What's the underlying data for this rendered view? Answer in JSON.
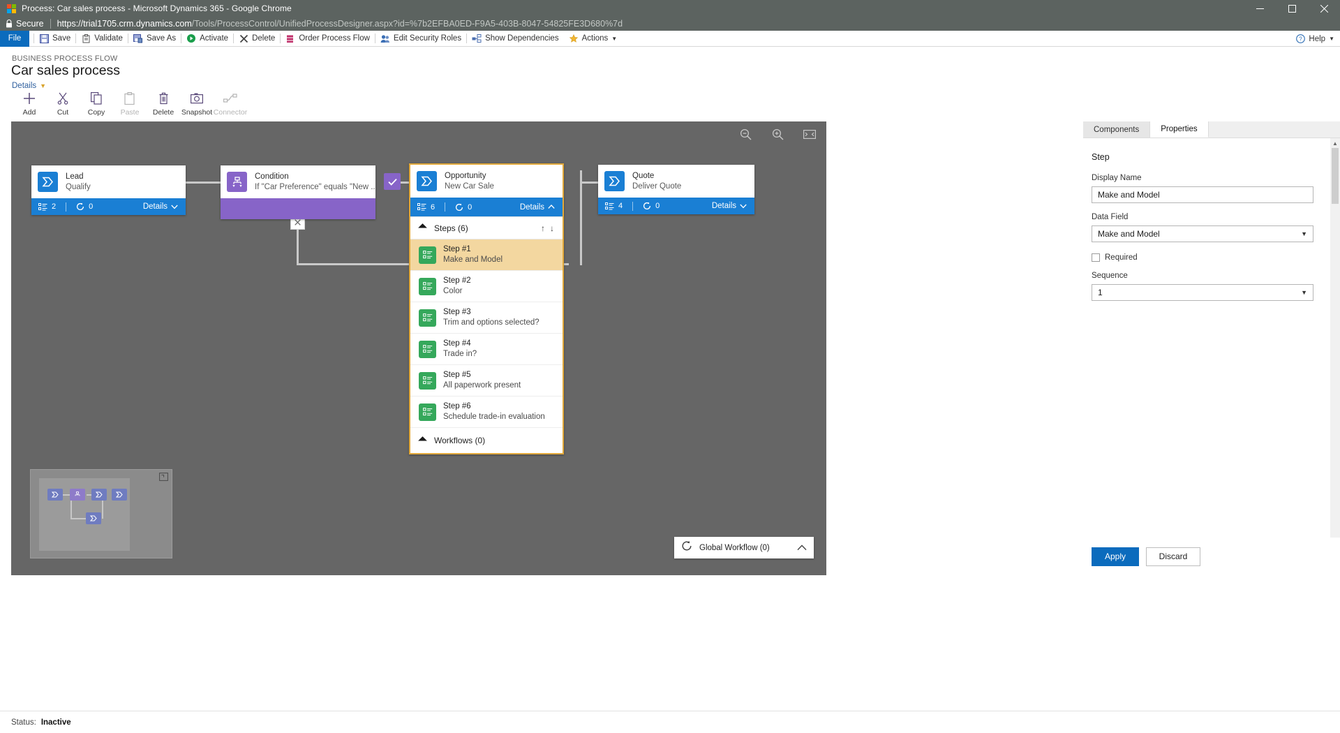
{
  "window": {
    "title": "Process: Car sales process - Microsoft Dynamics 365 - Google Chrome",
    "minimize": "minimize-icon",
    "maximize": "maximize-icon",
    "close": "close-icon"
  },
  "address": {
    "secure_label": "Secure",
    "url_host": "https://trial1705.crm.dynamics.com",
    "url_path": "/Tools/ProcessControl/UnifiedProcessDesigner.aspx?id=%7b2EFBA0ED-F9A5-403B-8047-54825FE3D680%7d"
  },
  "commandbar": {
    "file": "File",
    "items": [
      {
        "label": "Save",
        "icon": "save-icon"
      },
      {
        "label": "Validate",
        "icon": "validate-icon"
      },
      {
        "label": "Save As",
        "icon": "save-as-icon"
      },
      {
        "label": "Activate",
        "icon": "activate-icon"
      },
      {
        "label": "Delete",
        "icon": "delete-icon"
      },
      {
        "label": "Order Process Flow",
        "icon": "order-process-flow-icon"
      },
      {
        "label": "Edit Security Roles",
        "icon": "edit-security-roles-icon"
      },
      {
        "label": "Show Dependencies",
        "icon": "show-dependencies-icon"
      },
      {
        "label": "Actions",
        "icon": "actions-icon"
      }
    ],
    "help": "Help"
  },
  "header": {
    "kicker": "BUSINESS PROCESS FLOW",
    "title": "Car sales process",
    "details_link": "Details"
  },
  "toolbar": [
    {
      "label": "Add",
      "icon": "plus-icon",
      "disabled": false
    },
    {
      "label": "Cut",
      "icon": "scissors-icon",
      "disabled": false
    },
    {
      "label": "Copy",
      "icon": "copy-icon",
      "disabled": false
    },
    {
      "label": "Paste",
      "icon": "paste-icon",
      "disabled": true
    },
    {
      "label": "Delete",
      "icon": "trash-icon",
      "disabled": false
    },
    {
      "label": "Snapshot",
      "icon": "camera-icon",
      "disabled": false
    },
    {
      "label": "Connector",
      "icon": "connector-icon",
      "disabled": true
    }
  ],
  "canvas": {
    "tools": [
      {
        "name": "zoom-out-icon"
      },
      {
        "name": "zoom-in-icon"
      },
      {
        "name": "fit-to-screen-icon"
      }
    ],
    "stages": {
      "lead": {
        "name": "Lead",
        "subtitle": "Qualify",
        "steps_count": "2",
        "workflow_count": "0",
        "details": "Details"
      },
      "condition": {
        "name": "Condition",
        "subtitle": "If \"Car Preference\" equals \"New ..."
      },
      "opportunity": {
        "name": "Opportunity",
        "subtitle": "New Car Sale",
        "steps_count": "6",
        "workflow_count": "0",
        "details": "Details",
        "steps_header": "Steps (6)",
        "workflows_header": "Workflows (0)",
        "steps": [
          {
            "name": "Step #1",
            "value": "Make and Model",
            "selected": true
          },
          {
            "name": "Step #2",
            "value": "Color",
            "selected": false
          },
          {
            "name": "Step #3",
            "value": "Trim and options selected?",
            "selected": false
          },
          {
            "name": "Step #4",
            "value": "Trade in?",
            "selected": false
          },
          {
            "name": "Step #5",
            "value": "All paperwork present",
            "selected": false
          },
          {
            "name": "Step #6",
            "value": "Schedule trade-in evaluation",
            "selected": false
          }
        ]
      },
      "quote": {
        "name": "Quote",
        "subtitle": "Deliver Quote",
        "steps_count": "4",
        "workflow_count": "0",
        "details": "Details"
      }
    },
    "global_workflow": {
      "label": "Global Workflow (0)",
      "icon": "workflow-icon",
      "collapse_icon": "chevron-up-icon"
    },
    "minimap": {
      "expand_icon": "minimap-expand-icon"
    }
  },
  "properties": {
    "tabs": [
      {
        "label": "Components",
        "active": false
      },
      {
        "label": "Properties",
        "active": true
      }
    ],
    "heading": "Step",
    "display_name_label": "Display Name",
    "display_name_value": "Make and Model",
    "data_field_label": "Data Field",
    "data_field_value": "Make and Model",
    "required_label": "Required",
    "required_checked": false,
    "sequence_label": "Sequence",
    "sequence_value": "1",
    "apply_button": "Apply",
    "discard_button": "Discard"
  },
  "statusbar": {
    "key": "Status:",
    "value": "Inactive"
  },
  "colors": {
    "accent_blue": "#0b6bbd",
    "stage_blue": "#1a7fd4",
    "condition_purple": "#8764c8",
    "step_green": "#35a85b",
    "selected_step": "#f3d7a0",
    "canvas_gray": "#666666"
  }
}
